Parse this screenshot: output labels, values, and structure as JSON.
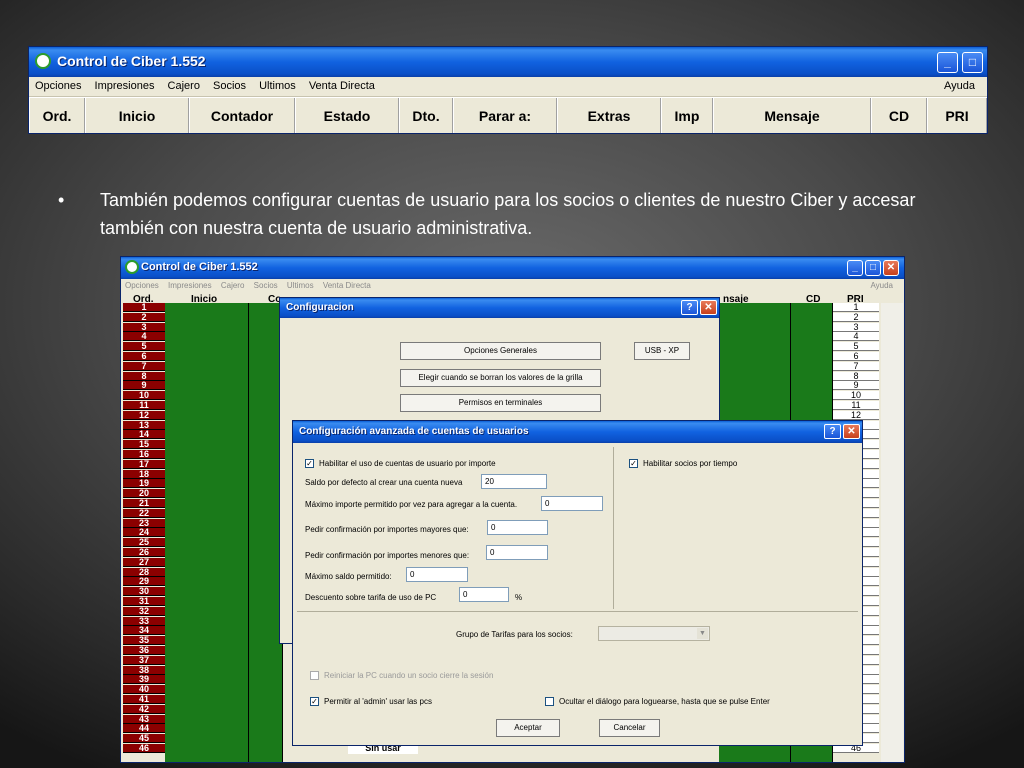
{
  "top_window": {
    "title": "Control de Ciber 1.552",
    "menu": [
      "Opciones",
      "Impresiones",
      "Cajero",
      "Socios",
      "Ultimos",
      "Venta Directa"
    ],
    "help": "Ayuda",
    "columns": [
      "Ord.",
      "Inicio",
      "Contador",
      "Estado",
      "Dto.",
      "Parar a:",
      "Extras",
      "Imp",
      "Mensaje",
      "CD",
      "PRI"
    ]
  },
  "bullet": {
    "symbol": "•",
    "text": "También podemos configurar cuentas de usuario para los socios o clientes de nuestro Ciber  y accesar también con nuestra cuenta de usuario administrativa."
  },
  "screenshot": {
    "title": "Control de Ciber 1.552",
    "menu": [
      "Opciones",
      "Impresiones",
      "Cajero",
      "Socios",
      "Ultimos",
      "Venta Directa"
    ],
    "help": "Ayuda",
    "columns": {
      "ord": "Ord.",
      "inicio": "Inicio",
      "co": "Co",
      "nsaje": "nsaje",
      "cd": "CD",
      "pri": "PRI"
    },
    "rows": [
      "1",
      "2",
      "3",
      "4",
      "5",
      "6",
      "7",
      "8",
      "9",
      "10",
      "11",
      "12",
      "13",
      "14",
      "15",
      "16",
      "17",
      "18",
      "19",
      "20",
      "21",
      "22",
      "23",
      "24",
      "25",
      "26",
      "27",
      "28",
      "29",
      "30",
      "31",
      "32",
      "33",
      "34",
      "35",
      "36",
      "37",
      "38",
      "39",
      "40",
      "41",
      "42",
      "43",
      "44",
      "45",
      "46"
    ],
    "last_row_estado": "Sin usar",
    "last_row_pri": "46"
  },
  "config_dialog": {
    "title": "Configuracion",
    "help_btn": "?",
    "close_btn": "✕",
    "opciones_generales": "Opciones Generales",
    "usb_xp": "USB - XP",
    "elegir": "Elegir cuando se borran los valores de la grilla",
    "permisos": "Permisos en terminales"
  },
  "advanced_dialog": {
    "title": "Configuración avanzada de cuentas de usuarios",
    "help_btn": "?",
    "close_btn": "✕",
    "habilitar_uso": "Habilitar el uso de cuentas de usuario por importe",
    "habilitar_socios": "Habilitar socios por tiempo",
    "saldo_label": "Saldo por defecto al crear una cuenta nueva",
    "saldo_value": "20",
    "maximo_importe_label": "Máximo importe permitido por vez para agregar a la cuenta.",
    "maximo_importe_value": "0",
    "conf_mayores_label": "Pedir confirmación por importes mayores que:",
    "conf_mayores_value": "0",
    "conf_menores_label": "Pedir confirmación por importes menores que:",
    "conf_menores_value": "0",
    "maximo_saldo_label": "Máximo saldo permitido:",
    "maximo_saldo_value": "0",
    "descuento_label": "Descuento sobre tarifa de uso de PC",
    "descuento_value": "0",
    "descuento_unit": "%",
    "grupo_label": "Grupo de Tarifas para los socios:",
    "reiniciar": "Reiniciar la PC cuando un socio cierre la sesión",
    "permitir_admin": "Permitir al 'admin' usar las pcs",
    "ocultar": "Ocultar el diálogo para loguearse, hasta que se pulse Enter",
    "aceptar": "Aceptar",
    "cancelar": "Cancelar",
    "check": "✓",
    "arrow": "▼"
  }
}
